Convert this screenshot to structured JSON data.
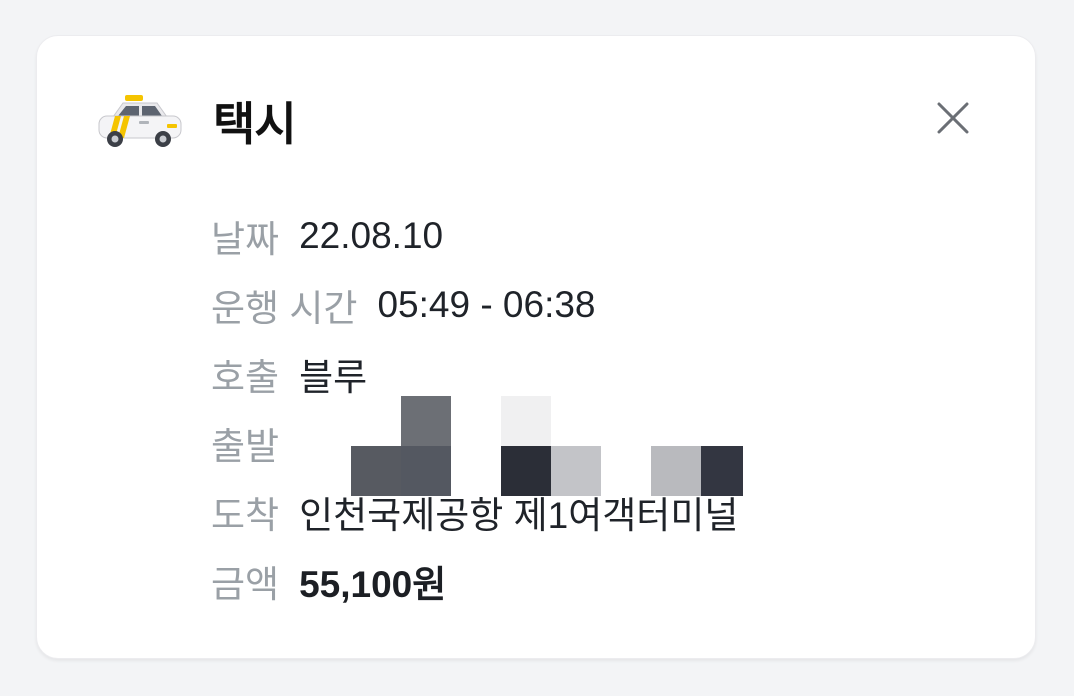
{
  "header": {
    "title": "택시",
    "icon": "taxi-icon",
    "close_icon": "close-icon"
  },
  "rows": [
    {
      "label": "날짜",
      "value": "22.08.10"
    },
    {
      "label": "운행 시간",
      "value": "05:49 - 06:38"
    },
    {
      "label": "호출",
      "value": "블루"
    },
    {
      "label": "출발",
      "value": ""
    },
    {
      "label": "도착",
      "value": "인천국제공항 제1여객터미널"
    },
    {
      "label": "금액",
      "value": "55,100원"
    }
  ],
  "colors": {
    "background": "#f3f4f6",
    "card": "#ffffff",
    "label": "#9aa0a6",
    "value": "#1f2329",
    "taxi_yellow": "#f5c400"
  }
}
